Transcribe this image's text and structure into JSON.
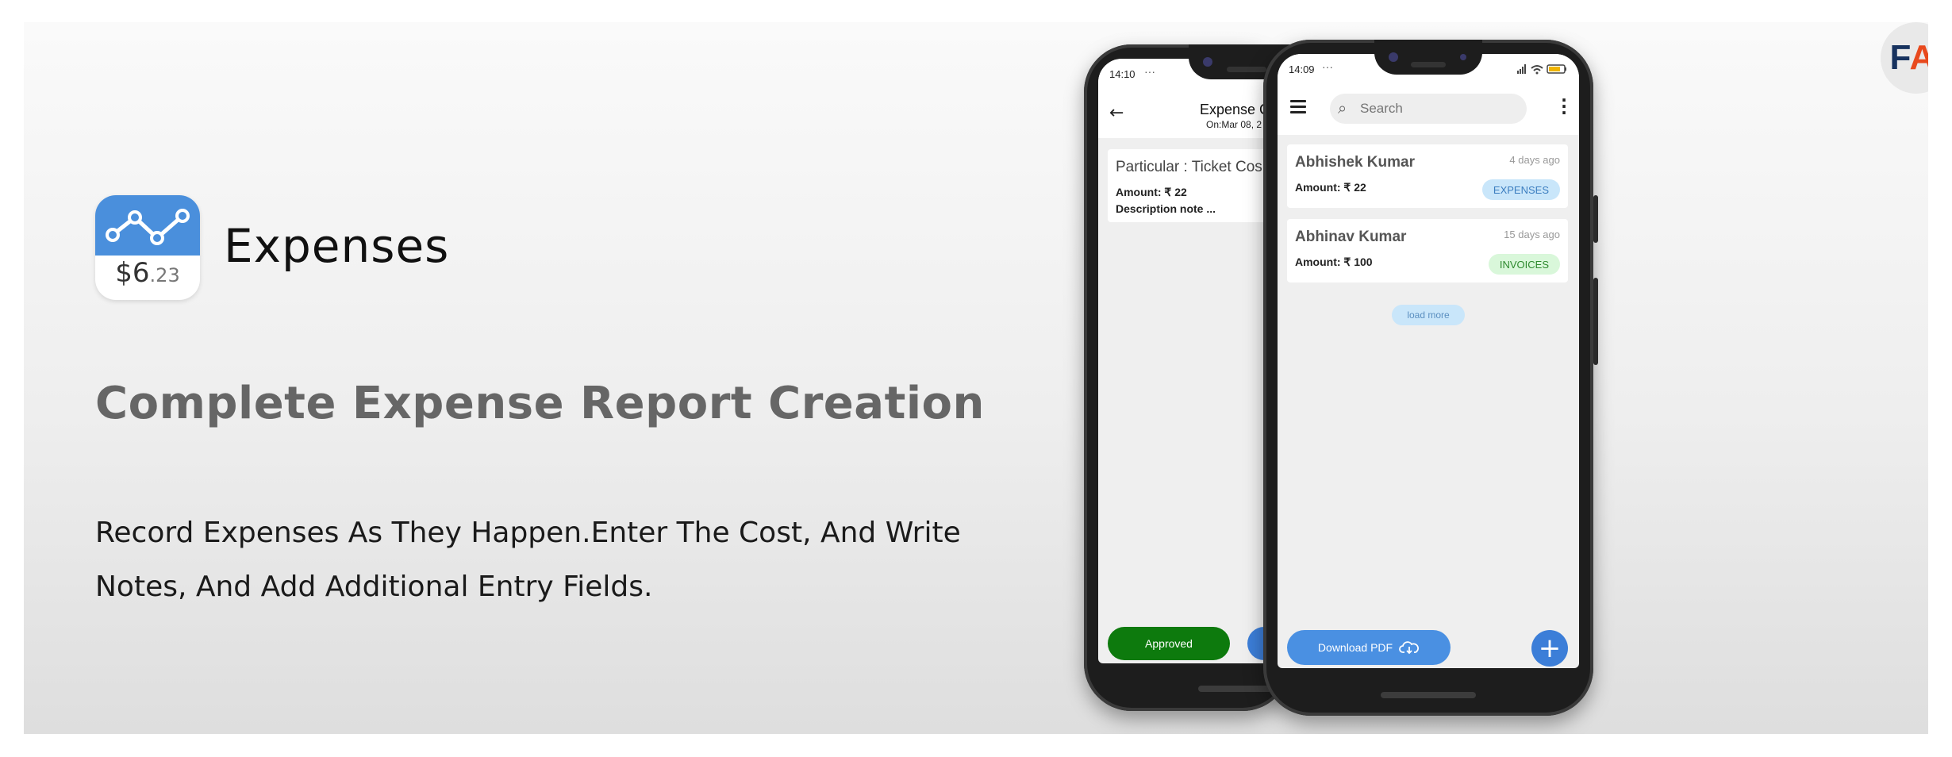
{
  "brand": {
    "logo_f": "F",
    "logo_ai": "AI",
    "icon": "fai-logo-icon"
  },
  "app": {
    "icon_amount_main": "$6",
    "icon_amount_cents": ".23",
    "name": "Expenses"
  },
  "headline": "Complete Expense Report Creation",
  "description": "Record Expenses As They Happen.Enter The Cost, And Write Notes, And Add Additional Entry Fields.",
  "back_phone": {
    "time": "14:10",
    "status_dots": "···",
    "title": "Expense C",
    "subtitle": "On:Mar 08, 2",
    "back_icon": "arrow-left-icon",
    "card": {
      "particular": "Particular : Ticket Cos",
      "amount": "Amount: ₹ 22",
      "note": "Description note ..."
    },
    "approved_label": "Approved"
  },
  "front_phone": {
    "time": "14:09",
    "status_dots": "···",
    "search_placeholder": "Search",
    "items": [
      {
        "name": "Abhishek Kumar",
        "amount": "Amount: ₹ 22",
        "time": "4 days ago",
        "tag": "EXPENSES"
      },
      {
        "name": "Abhinav Kumar",
        "amount": "Amount: ₹ 100",
        "time": "15 days ago",
        "tag": "INVOICES"
      }
    ],
    "load_more": "load more",
    "download_label": "Download PDF",
    "fab_label": "+"
  },
  "colors": {
    "accent_blue": "#4a90e2",
    "approved_green": "#0d7a0d",
    "tag_expenses_bg": "#c9e6fa",
    "tag_invoices_bg": "#d9f7da",
    "brand_navy": "#17325e",
    "brand_orange": "#e8491d"
  }
}
